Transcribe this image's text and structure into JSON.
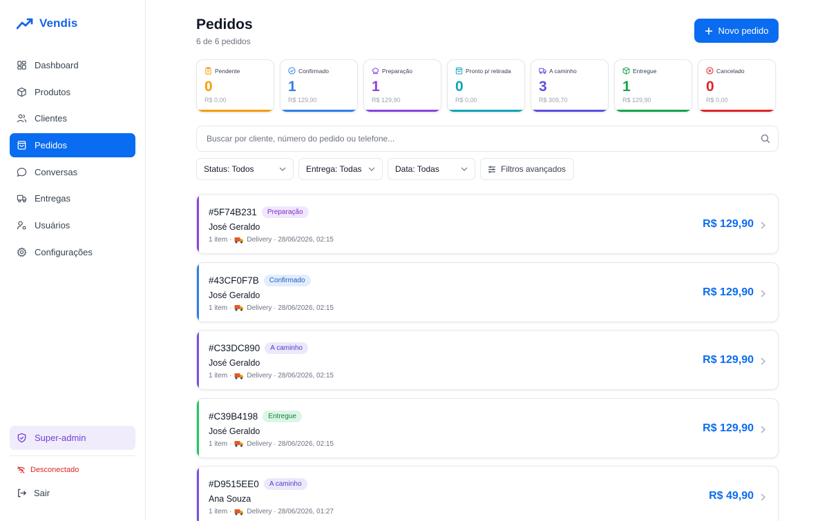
{
  "brand": {
    "name": "Vendis",
    "color": "#1565e8"
  },
  "nav": [
    {
      "label": "Dashboard",
      "icon": "dashboard-icon",
      "active": false
    },
    {
      "label": "Produtos",
      "icon": "box-icon",
      "active": false
    },
    {
      "label": "Clientes",
      "icon": "users-icon",
      "active": false
    },
    {
      "label": "Pedidos",
      "icon": "shopping-bag-icon",
      "active": true
    },
    {
      "label": "Conversas",
      "icon": "chat-icon",
      "active": false
    },
    {
      "label": "Entregas",
      "icon": "truck-icon",
      "active": false
    },
    {
      "label": "Usuários",
      "icon": "user-cog-icon",
      "active": false
    },
    {
      "label": "Configurações",
      "icon": "gear-icon",
      "active": false
    }
  ],
  "sidebar_footer": {
    "super_admin": "Super-admin",
    "status": "Desconectado",
    "logout": "Sair"
  },
  "header": {
    "title": "Pedidos",
    "subtitle": "6 de 6 pedidos",
    "new_order_label": "Novo pedido"
  },
  "stats": [
    {
      "label": "Pendente",
      "count": "0",
      "amount": "R$ 0,00",
      "color": "#f59e0b",
      "icon": "clipboard-icon"
    },
    {
      "label": "Confirmado",
      "count": "1",
      "amount": "R$ 129,90",
      "color": "#2f7fe6",
      "icon": "check-circle-icon"
    },
    {
      "label": "Preparação",
      "count": "1",
      "amount": "R$ 129,90",
      "color": "#8b44dc",
      "icon": "chef-hat-icon"
    },
    {
      "label": "Pronto p/ retirada",
      "count": "0",
      "amount": "R$ 0,00",
      "color": "#12a4b8",
      "icon": "bag-check-icon"
    },
    {
      "label": "A caminho",
      "count": "3",
      "amount": "R$ 309,70",
      "color": "#5b4ee0",
      "icon": "truck-icon"
    },
    {
      "label": "Entregue",
      "count": "1",
      "amount": "R$ 129,90",
      "color": "#16a34a",
      "icon": "package-check-icon"
    },
    {
      "label": "Cancelado",
      "count": "0",
      "amount": "R$ 0,00",
      "color": "#dc2626",
      "icon": "x-circle-icon"
    }
  ],
  "search": {
    "placeholder": "Buscar por cliente, número do pedido ou telefone..."
  },
  "filters": {
    "status": "Status: Todos",
    "delivery": "Entrega: Todas",
    "date": "Data: Todas",
    "advanced": "Filtros avançados"
  },
  "orders": [
    {
      "id": "#5F74B231",
      "status": "Preparação",
      "status_color": "#8b44dc",
      "badge_bg": "#f1e7fd",
      "badge_fg": "#7a2fc7",
      "customer": "José Geraldo",
      "items": "1 item ·",
      "delivery": "Delivery · 28/06/2026, 02:15",
      "price": "R$ 129,90"
    },
    {
      "id": "#43CF0F7B",
      "status": "Confirmado",
      "status_color": "#2f7fe6",
      "badge_bg": "#e2edfc",
      "badge_fg": "#1d5fc4",
      "customer": "José Geraldo",
      "items": "1 item ·",
      "delivery": "Delivery · 28/06/2026, 02:15",
      "price": "R$ 129,90"
    },
    {
      "id": "#C33DC890",
      "status": "A caminho",
      "status_color": "#7c4ee4",
      "badge_bg": "#ebe8fb",
      "badge_fg": "#4b3fc9",
      "customer": "José Geraldo",
      "items": "1 item ·",
      "delivery": "Delivery · 28/06/2026, 02:15",
      "price": "R$ 129,90"
    },
    {
      "id": "#C39B4198",
      "status": "Entregue",
      "status_color": "#22c55e",
      "badge_bg": "#dcf5e6",
      "badge_fg": "#15803d",
      "customer": "José Geraldo",
      "items": "1 item ·",
      "delivery": "Delivery · 28/06/2026, 02:15",
      "price": "R$ 129,90"
    },
    {
      "id": "#D9515EE0",
      "status": "A caminho",
      "status_color": "#7c4ee4",
      "badge_bg": "#ebe8fb",
      "badge_fg": "#4b3fc9",
      "customer": "Ana Souza",
      "items": "1 item ·",
      "delivery": "Delivery · 28/06/2026, 01:27",
      "price": "R$ 49,90"
    }
  ]
}
